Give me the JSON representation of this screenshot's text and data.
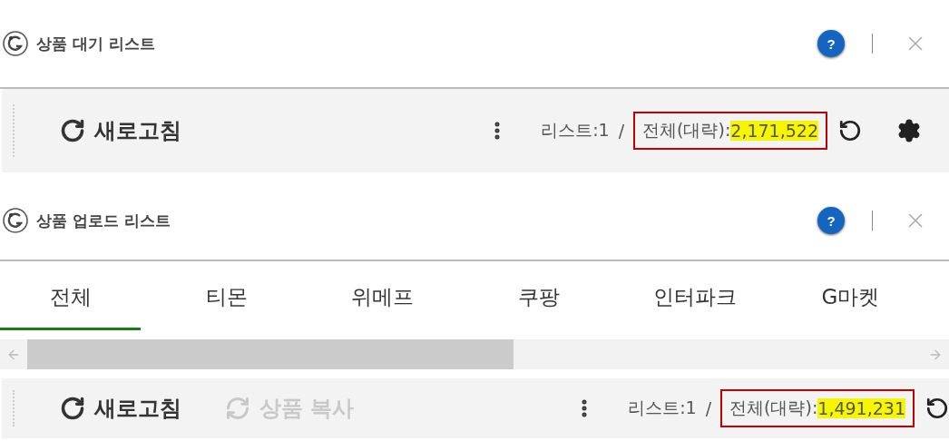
{
  "panels": [
    {
      "title": "상품 대기 리스트",
      "help": "?",
      "toolbar": {
        "buttons": [
          {
            "kind": "refresh",
            "label": "새로고침",
            "disabled": false
          }
        ],
        "list_count": "리스트:1",
        "separator": "/",
        "total_label": "전체(대략):",
        "total_value": "2,171,522",
        "highlighted": true,
        "tools": [
          {
            "kind": "reset"
          },
          {
            "kind": "settings"
          }
        ]
      }
    },
    {
      "title": "상품 업로드 리스트",
      "help": "?",
      "tabs": [
        {
          "label": "전체",
          "selected": true
        },
        {
          "label": "티몬",
          "selected": false
        },
        {
          "label": "위메프",
          "selected": false
        },
        {
          "label": "쿠팡",
          "selected": false
        },
        {
          "label": "인터파크",
          "selected": false
        },
        {
          "label": "G마켓",
          "selected": false
        }
      ],
      "toolbar": {
        "buttons": [
          {
            "kind": "refresh",
            "label": "새로고침",
            "disabled": false
          },
          {
            "kind": "copy",
            "label": "상품 복사",
            "disabled": true
          }
        ],
        "list_count": "리스트:1",
        "separator": "/",
        "total_label": "전체(대략):",
        "total_value": "1,491,231",
        "highlighted": true,
        "tools": [
          {
            "kind": "reset"
          }
        ]
      }
    }
  ]
}
